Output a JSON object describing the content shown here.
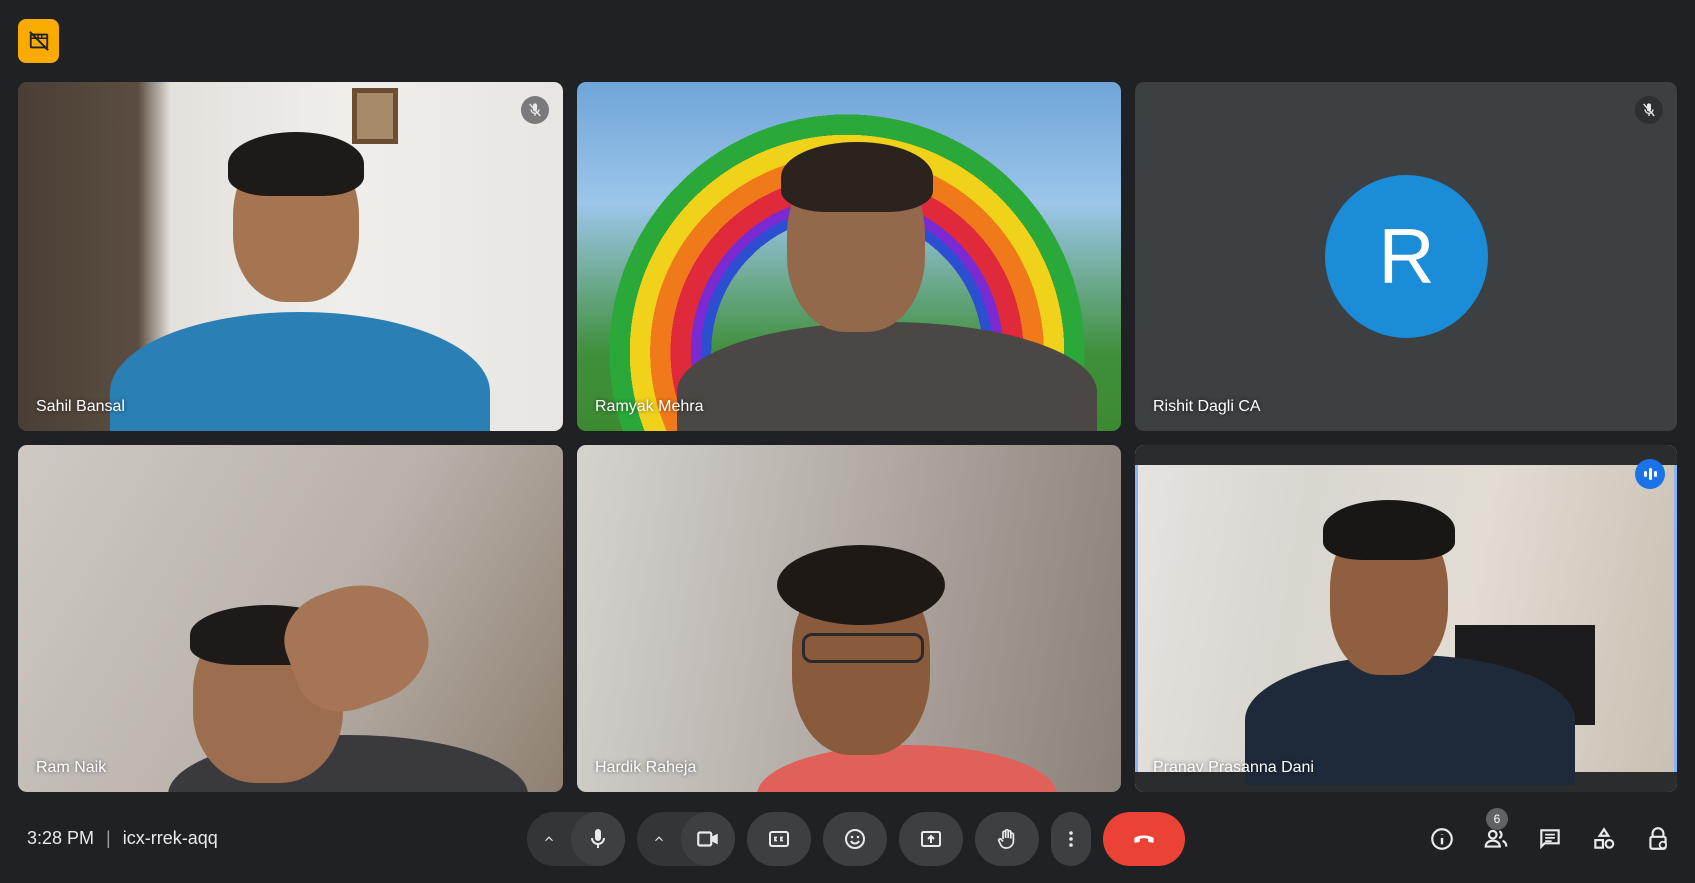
{
  "meeting": {
    "time": "3:28 PM",
    "code": "icx-rrek-aqq"
  },
  "participants": [
    {
      "name": "Sahil Bansal",
      "muted": true
    },
    {
      "name": "Ramyak Mehra",
      "muted": false
    },
    {
      "name": "Rishit Dagli CA",
      "muted": true,
      "avatar_letter": "R",
      "avatar_color": "#1a8cd8"
    },
    {
      "name": "Ram Naik",
      "muted": false
    },
    {
      "name": "Hardik Raheja",
      "muted": false
    },
    {
      "name": "Pranav Prasanna Dani",
      "muted": false,
      "speaking": true
    }
  ],
  "people_count": "6",
  "colors": {
    "background": "#202124",
    "end_call": "#ea4335",
    "speaking_outline": "#8ab4f8",
    "recording_badge": "#f9ab00"
  },
  "icons": {
    "top_left": "recording-off-icon",
    "toolbar": [
      "chevron-up-icon",
      "microphone-icon",
      "chevron-up-icon",
      "camera-icon",
      "captions-icon",
      "emoji-icon",
      "present-screen-icon",
      "raise-hand-icon",
      "more-vert-icon",
      "end-call-icon"
    ],
    "right": [
      "info-icon",
      "people-icon",
      "chat-icon",
      "activities-icon",
      "host-controls-icon"
    ]
  }
}
